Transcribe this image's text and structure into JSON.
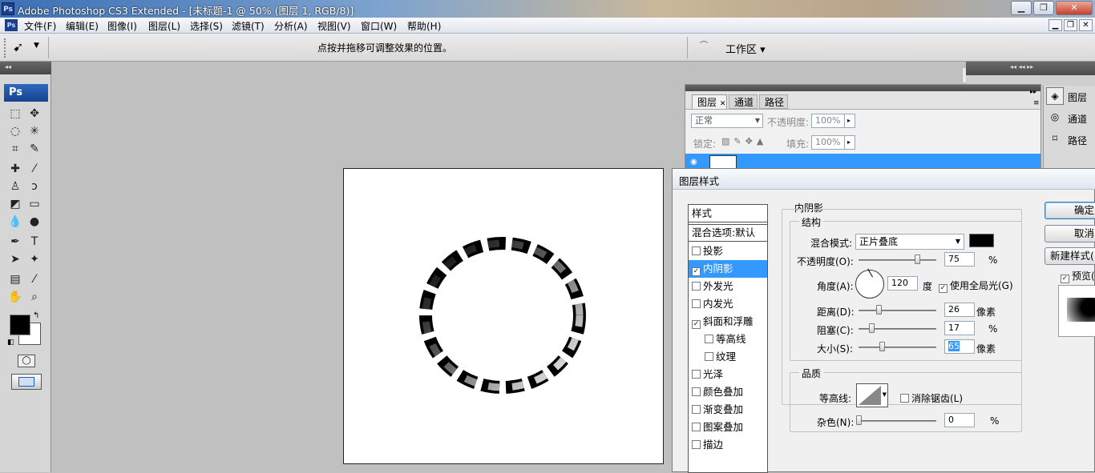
{
  "window": {
    "app_icon": "Ps",
    "title": "Adobe Photoshop CS3 Extended - [未标题-1 @ 50% (图层 1, RGB/8)]",
    "buttons": [
      "minimize-icon",
      "restore-icon",
      "close-icon"
    ]
  },
  "menu": {
    "app_icon": "Ps",
    "items": [
      "文件(F)",
      "编辑(E)",
      "图像(I)",
      "图层(L)",
      "选择(S)",
      "滤镜(T)",
      "分析(A)",
      "视图(V)",
      "窗口(W)",
      "帮助(H)"
    ]
  },
  "options_bar": {
    "hint": "点按并拖移可调整效果的位置。",
    "workspace": "工作区 ▾"
  },
  "toolbox": {
    "badge": "Ps"
  },
  "layers_panel": {
    "tabs": [
      "图层",
      "通道",
      "路径"
    ],
    "blend_mode": "正常",
    "opacity_label": "不透明度:",
    "opacity_value": "100%",
    "lock_label": "锁定:",
    "fill_label": "填充:",
    "fill_value": "100%"
  },
  "dock": {
    "items": [
      "图层",
      "通道",
      "路径"
    ]
  },
  "dialog": {
    "title": "图层样式",
    "styles_header": "样式",
    "blend_options": "混合选项:默认",
    "styles": [
      {
        "label": "投影",
        "checked": false,
        "active": false,
        "indent": false
      },
      {
        "label": "内阴影",
        "checked": true,
        "active": true,
        "indent": false
      },
      {
        "label": "外发光",
        "checked": false,
        "active": false,
        "indent": false
      },
      {
        "label": "内发光",
        "checked": false,
        "active": false,
        "indent": false
      },
      {
        "label": "斜面和浮雕",
        "checked": true,
        "active": false,
        "indent": false
      },
      {
        "label": "等高线",
        "checked": false,
        "active": false,
        "indent": true
      },
      {
        "label": "纹理",
        "checked": false,
        "active": false,
        "indent": true
      },
      {
        "label": "光泽",
        "checked": false,
        "active": false,
        "indent": false
      },
      {
        "label": "颜色叠加",
        "checked": false,
        "active": false,
        "indent": false
      },
      {
        "label": "渐变叠加",
        "checked": false,
        "active": false,
        "indent": false
      },
      {
        "label": "图案叠加",
        "checked": false,
        "active": false,
        "indent": false
      },
      {
        "label": "描边",
        "checked": false,
        "active": false,
        "indent": false
      }
    ],
    "section_title": "内阴影",
    "structure": {
      "legend": "结构",
      "blend_mode_label": "混合模式:",
      "blend_mode_value": "正片叠底",
      "opacity_label": "不透明度(O):",
      "opacity_value": "75",
      "opacity_unit": "%",
      "angle_label": "角度(A):",
      "angle_value": "120",
      "angle_unit": "度",
      "global_light_label": "使用全局光(G)",
      "global_light_checked": true,
      "distance_label": "距离(D):",
      "distance_value": "26",
      "distance_unit": "像素",
      "choke_label": "阻塞(C):",
      "choke_value": "17",
      "choke_unit": "%",
      "size_label": "大小(S):",
      "size_value": "65",
      "size_unit": "像素"
    },
    "quality": {
      "legend": "品质",
      "contour_label": "等高线:",
      "antialias_label": "消除锯齿(L)",
      "noise_label": "杂色(N):",
      "noise_value": "0",
      "noise_unit": "%"
    },
    "buttons": {
      "ok": "确定",
      "cancel": "取消",
      "new_style": "新建样式(",
      "preview": "预览("
    }
  }
}
